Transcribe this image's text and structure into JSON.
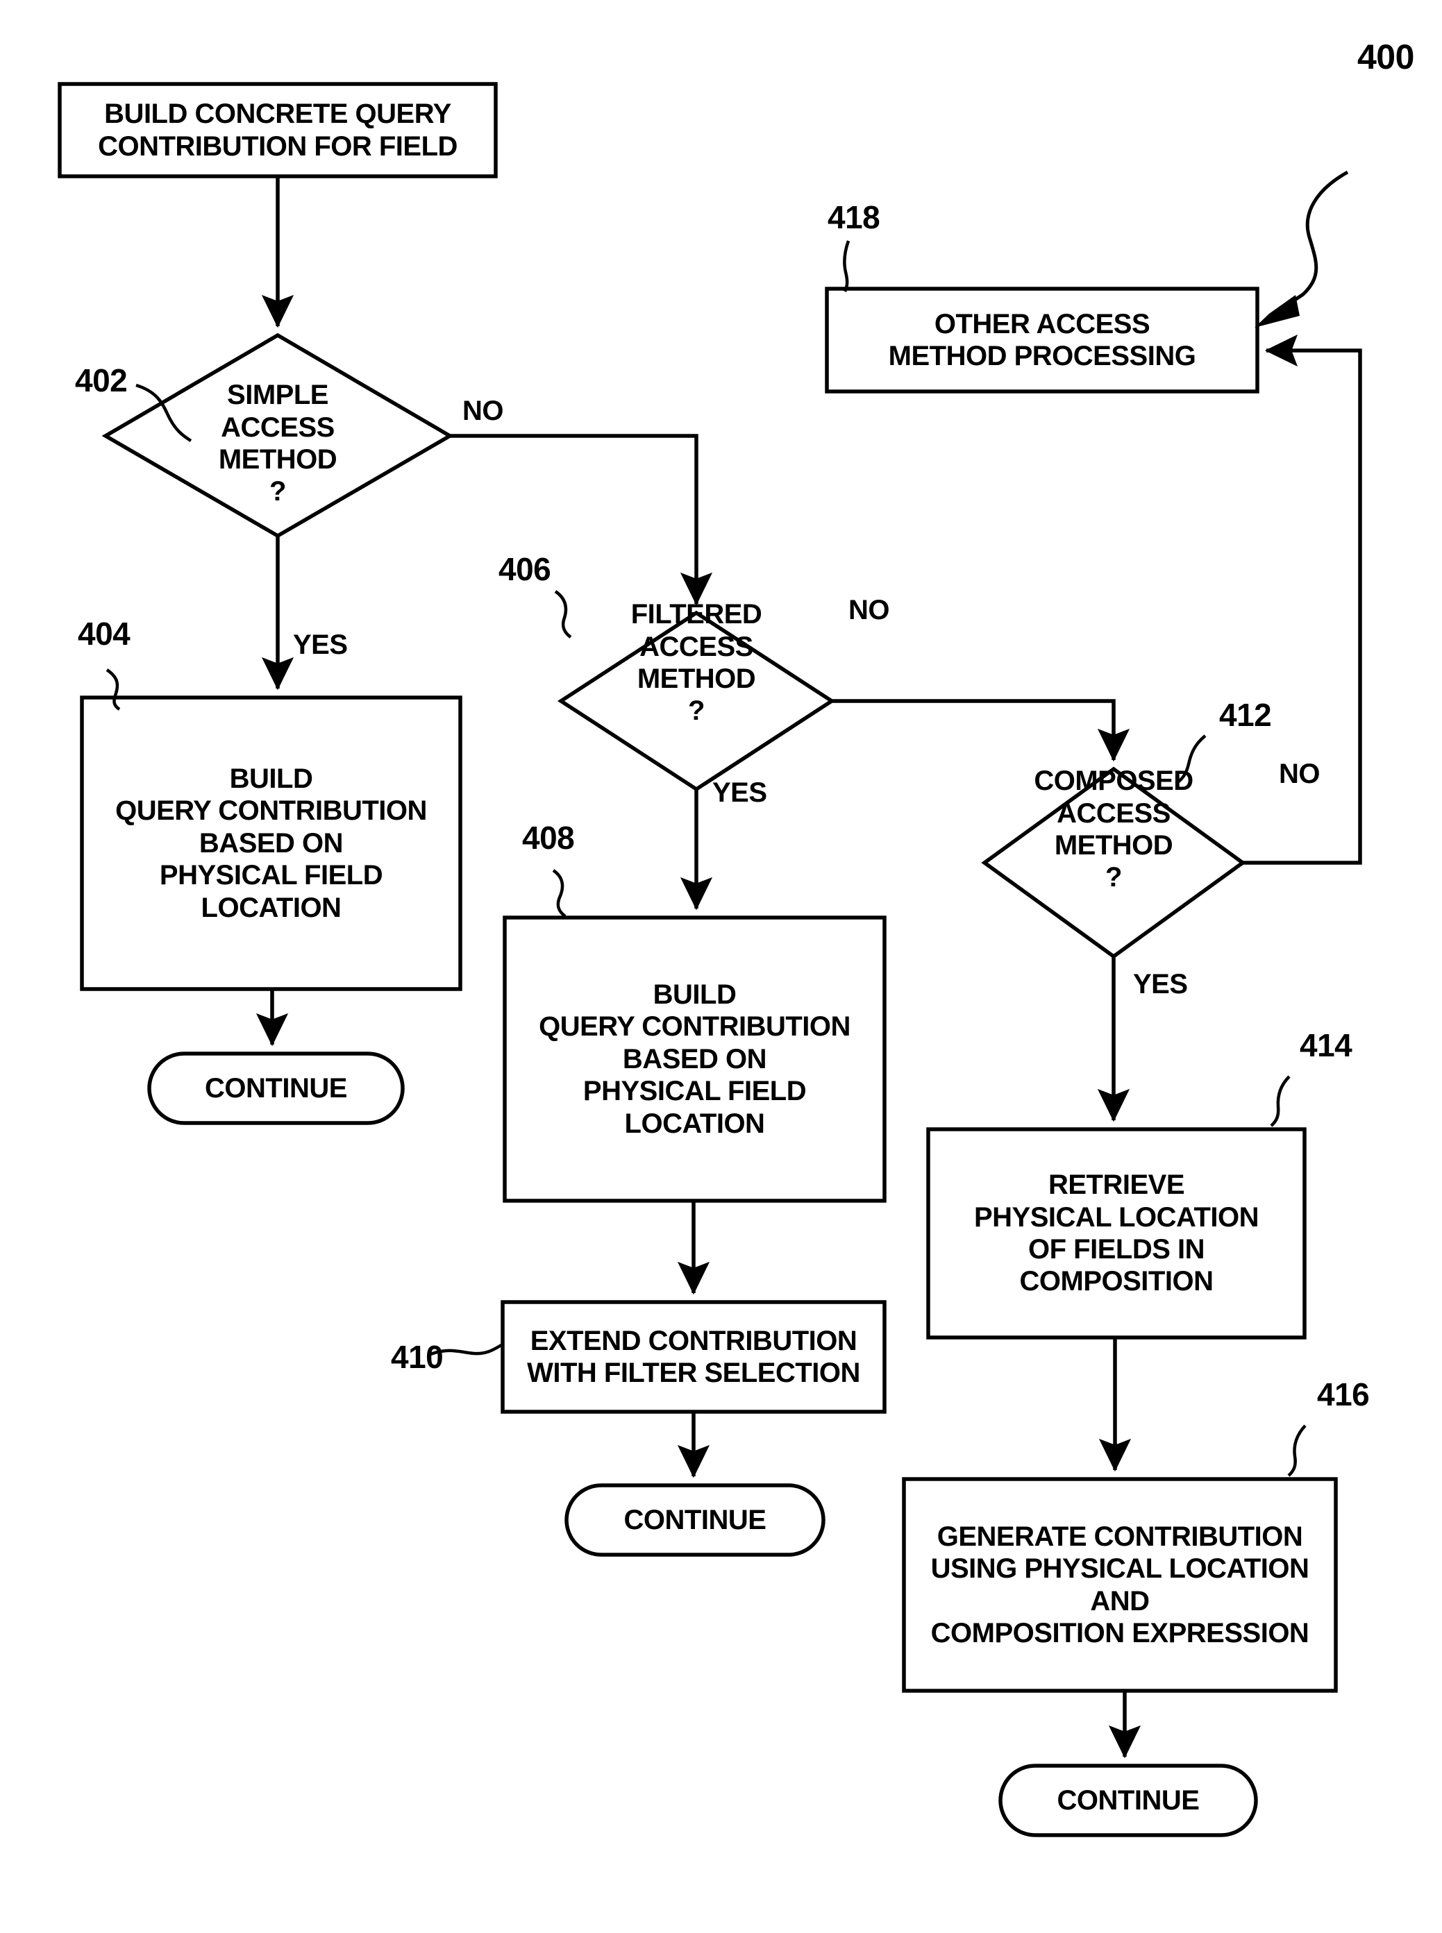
{
  "figure": {
    "number": "400",
    "kind": "flowchart"
  },
  "nodes": {
    "start": {
      "ref": "",
      "shape": "process",
      "lines": [
        "BUILD CONCRETE QUERY",
        "CONTRIBUTION FOR FIELD"
      ]
    },
    "n402": {
      "ref": "402",
      "shape": "decision",
      "lines": [
        "SIMPLE",
        "ACCESS",
        "METHOD",
        "?"
      ]
    },
    "n404": {
      "ref": "404",
      "shape": "process",
      "lines": [
        "BUILD",
        "QUERY CONTRIBUTION",
        "BASED ON",
        "PHYSICAL FIELD",
        "LOCATION"
      ]
    },
    "n404_continue": {
      "ref": "",
      "shape": "terminator",
      "lines": [
        "CONTINUE"
      ]
    },
    "n406": {
      "ref": "406",
      "shape": "decision",
      "lines": [
        "FILTERED",
        "ACCESS",
        "METHOD",
        "?"
      ]
    },
    "n408": {
      "ref": "408",
      "shape": "process",
      "lines": [
        "BUILD",
        "QUERY CONTRIBUTION",
        "BASED ON",
        "PHYSICAL FIELD",
        "LOCATION"
      ]
    },
    "n410": {
      "ref": "410",
      "shape": "process",
      "lines": [
        "EXTEND CONTRIBUTION",
        "WITH FILTER SELECTION"
      ]
    },
    "n410_continue": {
      "ref": "",
      "shape": "terminator",
      "lines": [
        "CONTINUE"
      ]
    },
    "n412": {
      "ref": "412",
      "shape": "decision",
      "lines": [
        "COMPOSED",
        "ACCESS",
        "METHOD",
        "?"
      ]
    },
    "n414": {
      "ref": "414",
      "shape": "process",
      "lines": [
        "RETRIEVE",
        "PHYSICAL LOCATION",
        "OF FIELDS IN",
        "COMPOSITION"
      ]
    },
    "n416": {
      "ref": "416",
      "shape": "process",
      "lines": [
        "GENERATE CONTRIBUTION",
        "USING PHYSICAL LOCATION",
        "AND",
        "COMPOSITION EXPRESSION"
      ]
    },
    "n416_continue": {
      "ref": "",
      "shape": "terminator",
      "lines": [
        "CONTINUE"
      ]
    },
    "n418": {
      "ref": "418",
      "shape": "process",
      "lines": [
        "OTHER ACCESS",
        "METHOD PROCESSING"
      ]
    }
  },
  "edge_labels": {
    "e402_no": "NO",
    "e402_yes": "YES",
    "e406_no": "NO",
    "e406_yes": "YES",
    "e412_no": "NO",
    "e412_yes": "YES"
  },
  "colors": {
    "stroke": "#000000",
    "fill": "#ffffff",
    "text": "#000000"
  }
}
